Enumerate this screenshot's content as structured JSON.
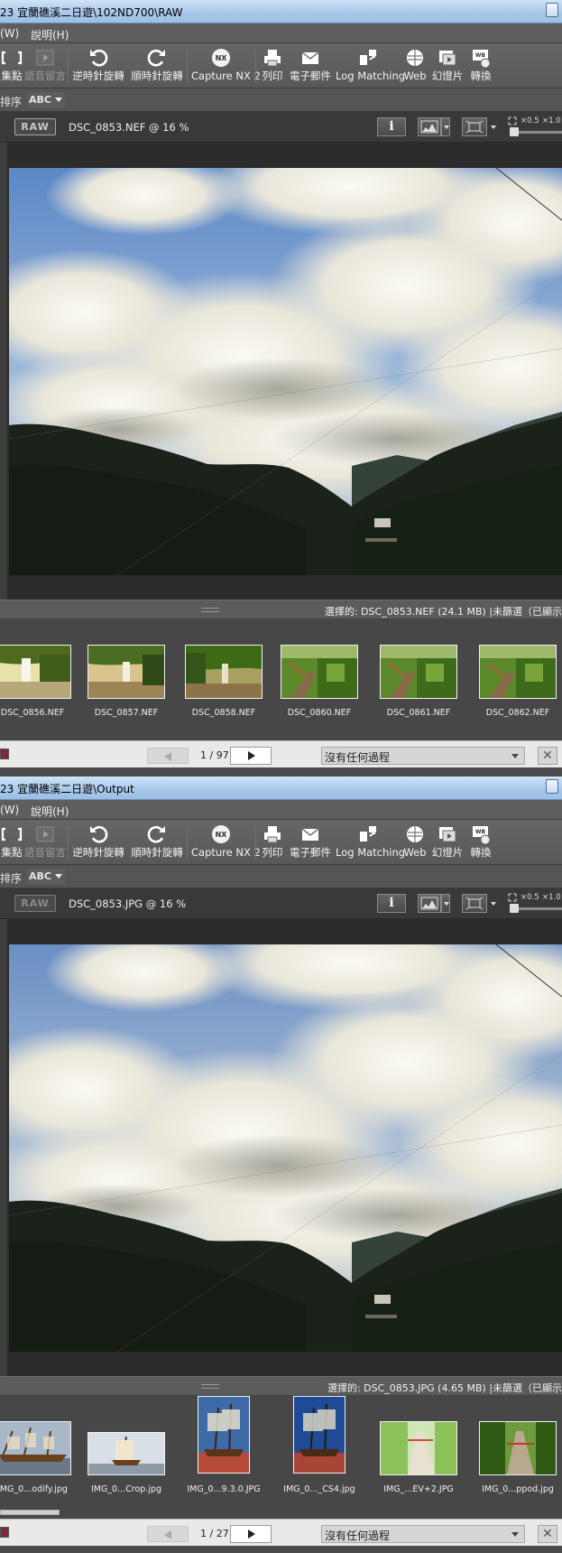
{
  "windows": [
    {
      "title": "23 宜蘭礁溪二日遊\\102ND700\\RAW",
      "menu": [
        "(W)",
        "說明(H)"
      ],
      "toolbar": [
        {
          "label": "集點",
          "icon": "bracket-icon",
          "enabled": true
        },
        {
          "label": "語音留言",
          "icon": "play-icon",
          "enabled": false
        },
        {
          "label": "逆時針旋轉",
          "icon": "rotate-ccw-icon",
          "enabled": true
        },
        {
          "label": "順時針旋轉",
          "icon": "rotate-cw-icon",
          "enabled": true
        },
        {
          "label": "Capture NX 2",
          "icon": "capture-nx-icon",
          "enabled": true
        },
        {
          "label": "列印",
          "icon": "printer-icon",
          "enabled": true
        },
        {
          "label": "電子郵件",
          "icon": "envelope-icon",
          "enabled": true
        },
        {
          "label": "Log Matching",
          "icon": "log-matching-icon",
          "enabled": true
        },
        {
          "label": "Web",
          "icon": "web-icon",
          "enabled": true
        },
        {
          "label": "幻燈片",
          "icon": "slideshow-icon",
          "enabled": true
        },
        {
          "label": "轉換",
          "icon": "convert-icon",
          "enabled": true
        }
      ],
      "sort": {
        "label": "排序",
        "value": "ABC"
      },
      "viewer": {
        "badge": "RAW",
        "caption": "DSC_0853.NEF @ 16 %",
        "zoom_labels": [
          "×0.5",
          "×1.0"
        ]
      },
      "status": "選擇的: DSC_0853.NEF (24.1 MB) |未篩選（已顯示",
      "thumbnails": [
        {
          "name": "DSC_0856.NEF",
          "scene": "falls-bright"
        },
        {
          "name": "DSC_0857.NEF",
          "scene": "falls-warm"
        },
        {
          "name": "DSC_0858.NEF",
          "scene": "falls-green"
        },
        {
          "name": "DSC_0860.NEF",
          "scene": "trail"
        },
        {
          "name": "DSC_0861.NEF",
          "scene": "trail"
        },
        {
          "name": "DSC_0862.NEF",
          "scene": "trail"
        }
      ],
      "nav": {
        "page": "1 / 97",
        "filter": "沒有任何過程"
      }
    },
    {
      "title": "23 宜蘭礁溪二日遊\\Output",
      "menu": [
        "(W)",
        "說明(H)"
      ],
      "toolbar": [
        {
          "label": "集點",
          "icon": "bracket-icon",
          "enabled": true
        },
        {
          "label": "語音留言",
          "icon": "play-icon",
          "enabled": false
        },
        {
          "label": "逆時針旋轉",
          "icon": "rotate-ccw-icon",
          "enabled": true
        },
        {
          "label": "順時針旋轉",
          "icon": "rotate-cw-icon",
          "enabled": true
        },
        {
          "label": "Capture NX 2",
          "icon": "capture-nx-icon",
          "enabled": true
        },
        {
          "label": "列印",
          "icon": "printer-icon",
          "enabled": true
        },
        {
          "label": "電子郵件",
          "icon": "envelope-icon",
          "enabled": true
        },
        {
          "label": "Log Matching",
          "icon": "log-matching-icon",
          "enabled": true
        },
        {
          "label": "Web",
          "icon": "web-icon",
          "enabled": true
        },
        {
          "label": "幻燈片",
          "icon": "slideshow-icon",
          "enabled": true
        },
        {
          "label": "轉換",
          "icon": "convert-icon",
          "enabled": true
        }
      ],
      "sort": {
        "label": "排序",
        "value": "ABC"
      },
      "viewer": {
        "badge": "RAW",
        "caption": "DSC_0853.JPG @ 16 %",
        "zoom_labels": [
          "×0.5",
          "×1.0"
        ]
      },
      "status": "選擇的: DSC_0853.JPG (4.65 MB) |未篩選（已顯示",
      "thumbnails": [
        {
          "name": "IMG_0...odify.jpg",
          "scene": "ship-wide"
        },
        {
          "name": "IMG_0...Crop.jpg",
          "scene": "ship-crop"
        },
        {
          "name": "IMG_0...9.3.0.JPG",
          "scene": "ship-tall"
        },
        {
          "name": "IMG_0..._CS4.jpg",
          "scene": "ship-tall-blue"
        },
        {
          "name": "IMG_...EV+2.JPG",
          "scene": "stairs-bright"
        },
        {
          "name": "IMG_0...ppod.jpg",
          "scene": "stairs"
        }
      ],
      "nav": {
        "page": "1 / 27",
        "filter": "沒有任何過程"
      }
    }
  ]
}
